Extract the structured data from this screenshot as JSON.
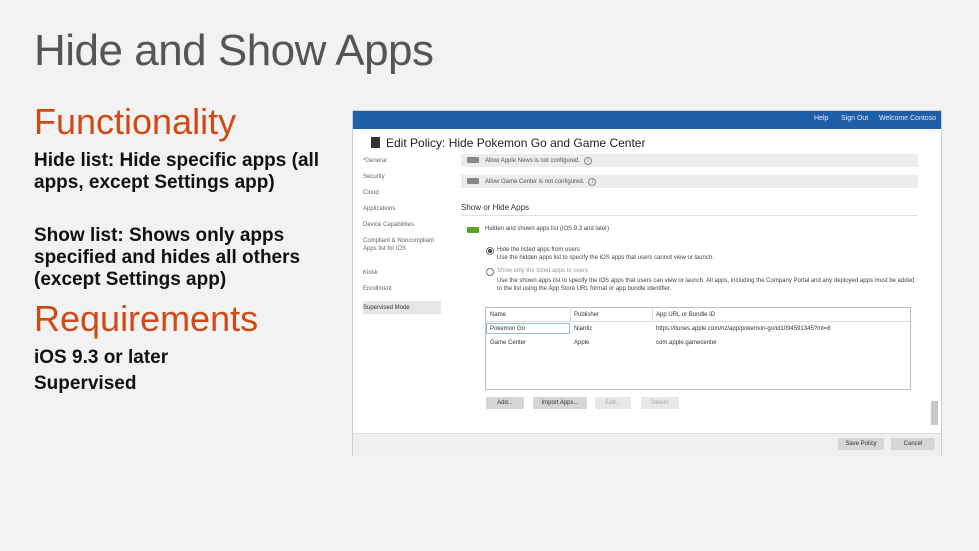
{
  "slide": {
    "title": "Hide and Show Apps",
    "functionality_heading": "Functionality",
    "hide_list_text": "Hide list: Hide specific apps (all apps, except Settings app)",
    "show_list_text": "Show list: Shows only apps specified and hides all others (except Settings app)",
    "requirements_heading": "Requirements",
    "requirement_1": "iOS 9.3 or later",
    "requirement_2": "Supervised"
  },
  "screenshot": {
    "topbar": {
      "help": "Help",
      "sign_out": "Sign Out",
      "welcome": "Welcome Contoso"
    },
    "header_title": "Edit Policy: Hide Pokemon Go and Game Center",
    "sidebar": [
      "*General",
      "Security",
      "Cloud",
      "Applications",
      "Device Capabilities",
      "Compliant & Noncompliant Apps list for iOS",
      "Kiosk",
      "Enrollment",
      "Supervised Mode"
    ],
    "settings": {
      "apple_news": "Allow Apple News is not configured.",
      "game_center": "Allow Game Center is not configured."
    },
    "section_title": "Show or Hide Apps",
    "apps_list_label": "Hidden and shown apps list (iOS 9.3 and later)",
    "option_hide_title": "Hide the listed apps from users",
    "option_hide_desc": "Use the hidden apps list to specify the iOS apps that users cannot view or launch.",
    "option_show_title": "Show only the listed apps to users",
    "option_show_desc": "Use the shown apps list to specify the iOS apps that users can view or launch. All apps, including the Company Portal and any deployed apps must be added to the list using the App Store URL format or app bundle identifier.",
    "table": {
      "columns": [
        "Name",
        "Publisher",
        "App URL or Bundle ID"
      ],
      "rows": [
        [
          "Pokemon Go",
          "Niantic",
          "https://itunes.apple.com/nz/app/pokemon-go/id1094591345?mt=8"
        ],
        [
          "Game Center",
          "Apple",
          "com.apple.gamecenter"
        ]
      ]
    },
    "buttons": {
      "add": "Add...",
      "import": "Import Apps...",
      "edit": "Edit...",
      "delete": "Delete"
    },
    "footer": {
      "save": "Save Policy",
      "cancel": "Cancel"
    },
    "colors": {
      "topbar": "#1f5ea8",
      "accent_orange": "#d04a16",
      "toggle_green": "#5aa52c"
    }
  }
}
